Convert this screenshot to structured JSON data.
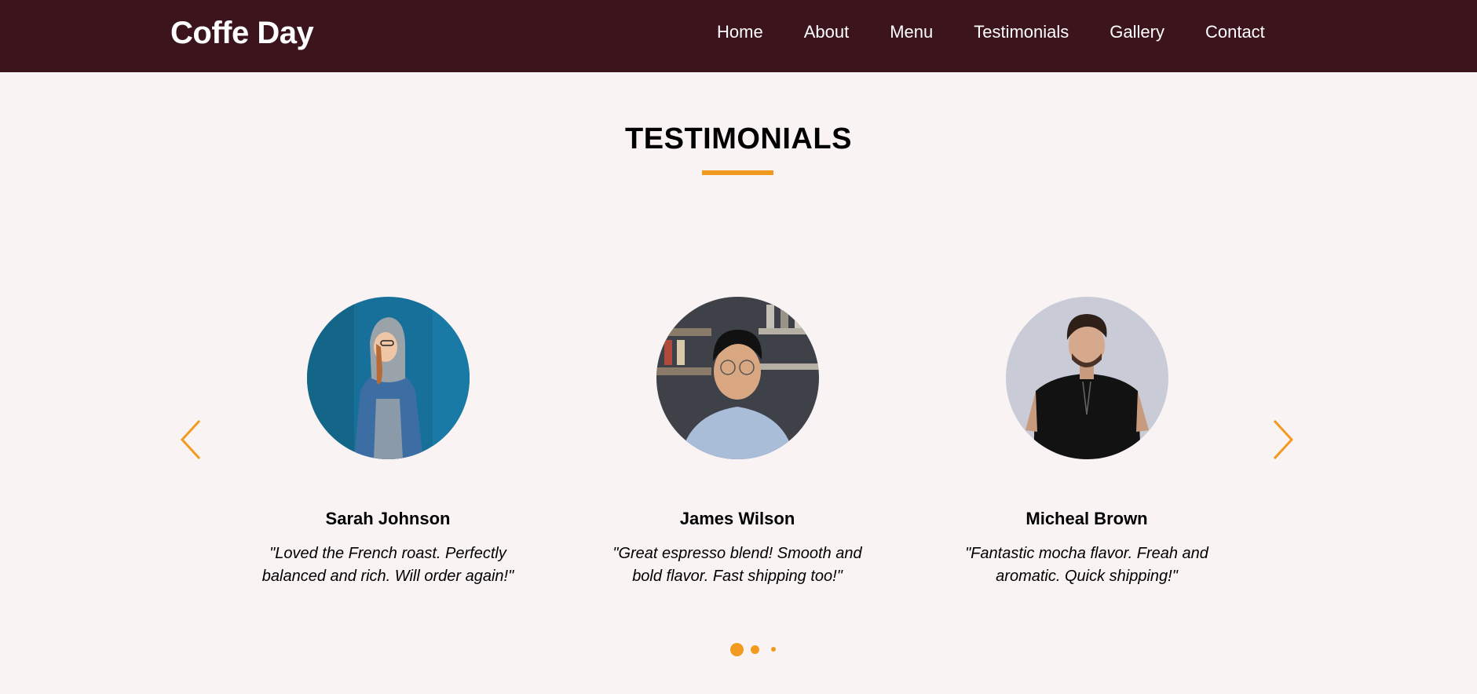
{
  "header": {
    "brand": "Coffe Day",
    "nav": [
      "Home",
      "About",
      "Menu",
      "Testimonials",
      "Gallery",
      "Contact"
    ]
  },
  "section": {
    "title": "TESTIMONIALS"
  },
  "testimonials": [
    {
      "name": "Sarah Johnson",
      "quote": "\"Loved the French roast. Perfectly balanced and rich. Will order again!\""
    },
    {
      "name": "James Wilson",
      "quote": "\"Great espresso blend! Smooth and bold flavor. Fast shipping too!\""
    },
    {
      "name": "Micheal Brown",
      "quote": "\"Fantastic mocha flavor. Freah and aromatic. Quick shipping!\""
    }
  ],
  "carousel": {
    "prev_icon": "chevron-left-icon",
    "next_icon": "chevron-right-icon",
    "dot_count": 3,
    "active_dot": 1
  },
  "colors": {
    "header_bg": "#3c141c",
    "page_bg": "#f9f3f3",
    "accent": "#f29a1f"
  }
}
